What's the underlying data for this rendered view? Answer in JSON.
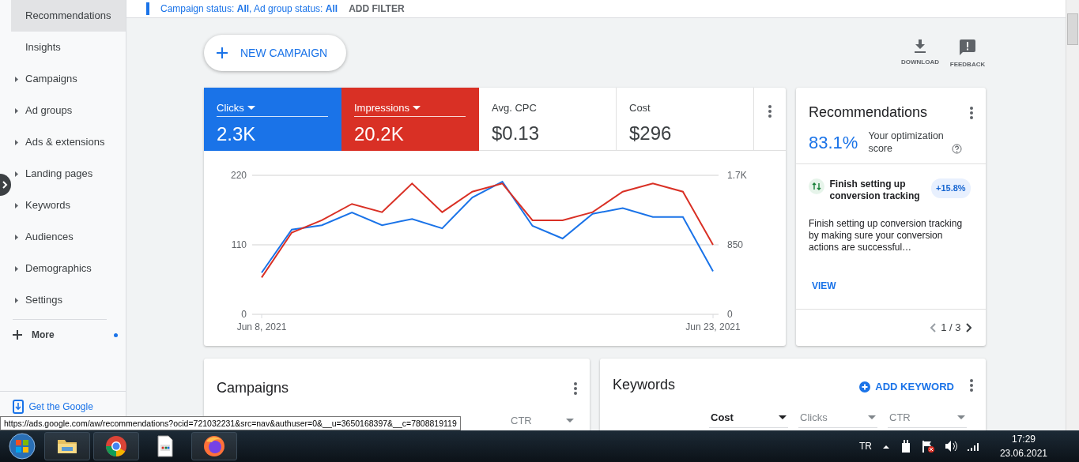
{
  "filter_bar": {
    "text": "Campaign status: **All**, Ad group status: **All**",
    "action": "ADD FILTER"
  },
  "sidebar": {
    "items": [
      {
        "label": "Recommendations",
        "kind": "plain",
        "selected": true
      },
      {
        "label": "Insights",
        "kind": "plain",
        "selected": false
      },
      {
        "label": "Campaigns",
        "kind": "expandable",
        "selected": false
      },
      {
        "label": "Ad groups",
        "kind": "expandable",
        "selected": false
      },
      {
        "label": "Ads & extensions",
        "kind": "expandable",
        "selected": false
      },
      {
        "label": "Landing pages",
        "kind": "expandable",
        "selected": false
      },
      {
        "label": "Keywords",
        "kind": "expandable",
        "selected": false
      },
      {
        "label": "Audiences",
        "kind": "expandable",
        "selected": false
      },
      {
        "label": "Demographics",
        "kind": "expandable",
        "selected": false
      },
      {
        "label": "Settings",
        "kind": "expandable",
        "selected": false
      }
    ],
    "more": {
      "label": "More",
      "unread": true
    },
    "app_link": "Get the Google"
  },
  "toolbar": {
    "new_campaign": "NEW CAMPAIGN",
    "actions": [
      {
        "label": "DOWNLOAD",
        "kind": "download"
      },
      {
        "label": "FEEDBACK",
        "kind": "feedback"
      }
    ]
  },
  "metrics": [
    {
      "label": "Clicks",
      "value": "2.3K",
      "selected": true,
      "color": "#1a73e8"
    },
    {
      "label": "Impressions",
      "value": "20.2K",
      "selected": true,
      "color": "#d93025"
    },
    {
      "label": "Avg. CPC",
      "value": "$0.13",
      "selected": false
    },
    {
      "label": "Cost",
      "value": "$296",
      "selected": false
    }
  ],
  "chart": {
    "chart_data": {
      "type": "line",
      "categories": [
        "Jun 8, 2021",
        null,
        null,
        null,
        null,
        null,
        null,
        null,
        null,
        null,
        null,
        null,
        null,
        null,
        null,
        "Jun 23, 2021"
      ],
      "series": [
        {
          "color": "#1a73e8",
          "values": [
            66,
            134,
            141,
            161,
            141,
            151,
            136,
            185,
            210,
            140,
            120,
            159,
            168,
            154,
            154,
            68
          ]
        },
        {
          "color": "#d93025",
          "axis": "y2",
          "values": [
            450,
            1000,
            1150,
            1350,
            1250,
            1600,
            1250,
            1500,
            1600,
            1150,
            1150,
            1250,
            1500,
            1600,
            1500,
            850
          ]
        }
      ],
      "ylim": [
        0,
        220
      ],
      "yticks": [
        0,
        110,
        220
      ],
      "y2lim": [
        0,
        1700
      ],
      "y2ticks": [
        {
          "value": 0,
          "label": "0"
        },
        {
          "value": 850,
          "label": "850"
        },
        {
          "value": 1700,
          "label": "1.7K"
        }
      ]
    }
  },
  "recommendations": {
    "title": "Recommendations",
    "score": "83.1%",
    "score_label": "Your optimization score",
    "item": {
      "title": "Finish setting up conversion tracking",
      "badge": "+15.8%",
      "description": "Finish setting up conversion tracking by making sure your conversion actions are successful…",
      "action": "VIEW"
    },
    "pager": "1 / 3"
  },
  "campaigns": {
    "title": "Campaigns",
    "columns": [
      {
        "label": "CTR",
        "selected": false
      }
    ]
  },
  "keywords": {
    "title": "Keywords",
    "action": "ADD KEYWORD",
    "columns": [
      {
        "label": "Cost",
        "selected": true
      },
      {
        "label": "Clicks",
        "selected": false
      },
      {
        "label": "CTR",
        "selected": false
      }
    ]
  },
  "status_url": "https://ads.google.com/aw/recommendations?ocid=721032231&src=nav&authuser=0&__u=3650168397&__c=7808819119",
  "taskbar": {
    "apps": [
      {
        "kind": "explorer"
      },
      {
        "kind": "chrome"
      },
      {
        "kind": "document"
      },
      {
        "kind": "firefox"
      }
    ],
    "language": "TR",
    "time": "17:29",
    "date": "23.06.2021"
  }
}
